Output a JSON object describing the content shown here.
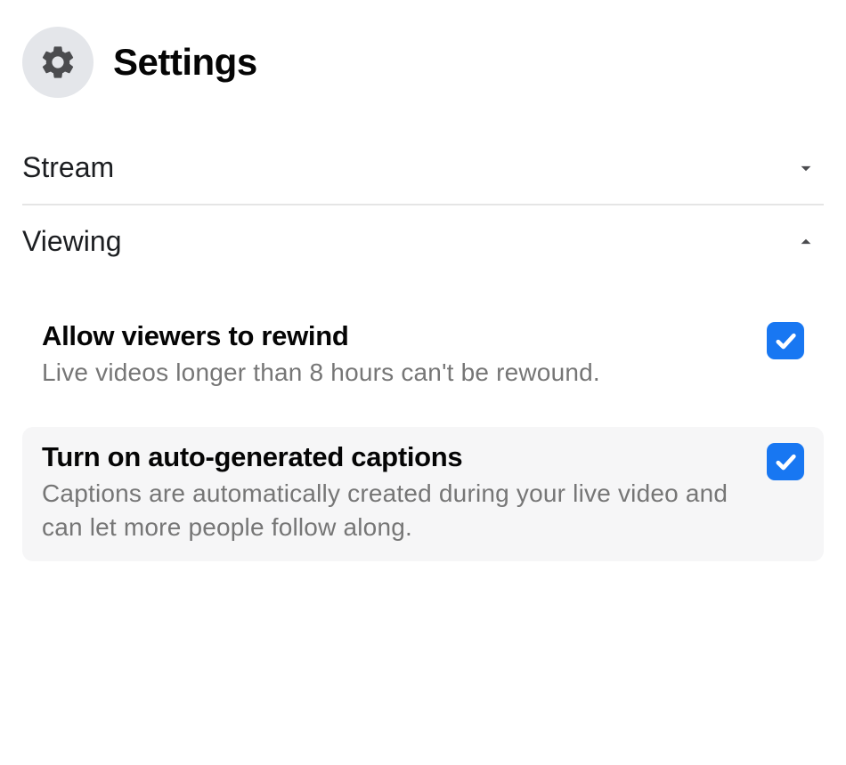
{
  "header": {
    "title": "Settings"
  },
  "sections": {
    "stream": {
      "title": "Stream"
    },
    "viewing": {
      "title": "Viewing",
      "items": [
        {
          "label": "Allow viewers to rewind",
          "description": "Live videos longer than 8 hours can't be rewound.",
          "checked": true
        },
        {
          "label": "Turn on auto-generated captions",
          "description": "Captions are automatically created during your live video and can let more people follow along.",
          "checked": true
        }
      ]
    }
  }
}
